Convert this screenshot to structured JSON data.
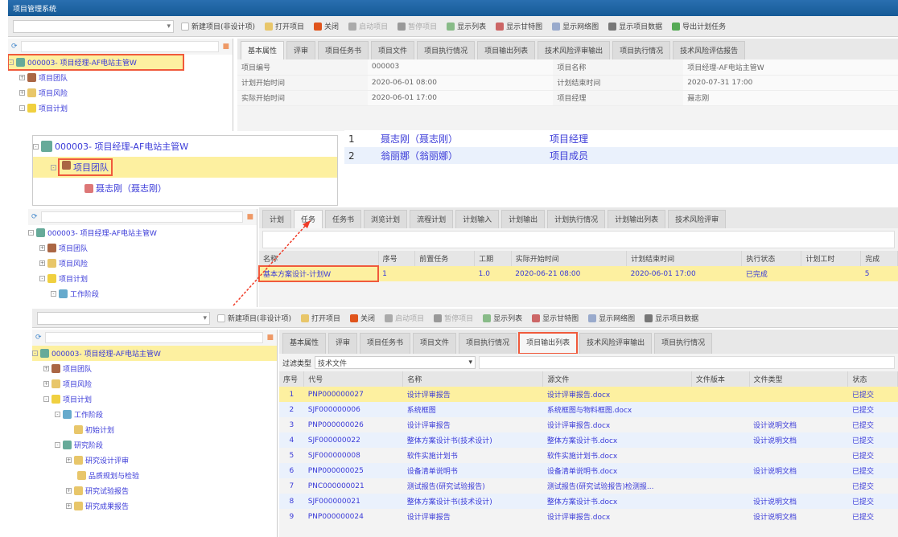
{
  "window": {
    "title": "项目管理系统"
  },
  "toolbar": {
    "items": [
      "新建项目(非设计项)",
      "打开项目",
      "关闭",
      "启动项目",
      "暂停项目",
      "显示列表",
      "显示甘特图",
      "显示网络图",
      "显示项目数据",
      "导出计划任务"
    ]
  },
  "tree": {
    "root": "000003- 项目经理-AF电站主管W",
    "nodes": [
      "项目团队",
      "项目风险",
      "项目计划",
      "工作阶段",
      "初始计划",
      "研究阶段",
      "研究设计评审",
      "品质规划与检验",
      "研究试验报告",
      "研究成果报告"
    ],
    "member": "聂志刚（聂志刚）"
  },
  "top_tabs": [
    "基本属性",
    "评审",
    "项目任务书",
    "项目文件",
    "项目执行情况",
    "项目输出列表",
    "技术风险评审输出",
    "项目执行情况",
    "技术风险评估报告"
  ],
  "form": [
    {
      "label": "项目编号",
      "value": "000003",
      "label2": "项目名称",
      "value2": "项目经理-AF电站主管W"
    },
    {
      "label": "计划开始时间",
      "value": "2020-06-01 08:00",
      "label2": "计划结束时间",
      "value2": "2020-07-31 17:00"
    },
    {
      "label": "实际开始时间",
      "value": "2020-06-01 17:00",
      "label2": "项目经理",
      "value2": "聂志刚"
    }
  ],
  "team": [
    {
      "no": "1",
      "name": "聂志刚（聂志刚）",
      "role": "项目经理"
    },
    {
      "no": "2",
      "name": "翁丽娜（翁丽娜）",
      "role": "项目成员"
    }
  ],
  "mid_tabs": [
    "计划",
    "任务",
    "任务书",
    "浏览计划",
    "流程计划",
    "计划输入",
    "计划输出",
    "计划执行情况",
    "计划输出列表",
    "技术风险评审"
  ],
  "mid_table": {
    "headers": [
      "名称",
      "序号",
      "前置任务",
      "工期",
      "实际开始时间",
      "计划结束时间",
      "执行状态",
      "计划工时",
      "完成"
    ],
    "row": [
      "基本方案设计-计划W",
      "1",
      "",
      "1.0",
      "2020-06-21 08:00",
      "2020-06-01 17:00",
      "已完成",
      "",
      "5"
    ]
  },
  "bottom_tabs": [
    "基本属性",
    "评审",
    "项目任务书",
    "项目文件",
    "项目执行情况",
    "项目输出列表",
    "技术风险评审输出",
    "项目执行情况"
  ],
  "filter": {
    "label": "过滤类型",
    "value": "技术文件"
  },
  "doc_table": {
    "headers": [
      "序号",
      "代号",
      "名称",
      "源文件",
      "文件版本",
      "文件类型",
      "状态"
    ],
    "rows": [
      [
        "1",
        "PNP000000027",
        "设计评审报告",
        "设计评审报告.docx",
        "",
        "",
        "已提交"
      ],
      [
        "2",
        "SJF000000006",
        "系统框图",
        "系统框图与物料框图.docx",
        "",
        "",
        "已提交"
      ],
      [
        "3",
        "PNP000000026",
        "设计评审报告",
        "设计评审报告.docx",
        "",
        "设计说明文档",
        "已提交"
      ],
      [
        "4",
        "SJF000000022",
        "整体方案设计书(技术设计)",
        "整体方案设计书.docx",
        "",
        "设计说明文档",
        "已提交"
      ],
      [
        "5",
        "SJF000000008",
        "软件实施计划书",
        "软件实施计划书.docx",
        "",
        "",
        "已提交"
      ],
      [
        "6",
        "PNP000000025",
        "设备清单说明书",
        "设备清单说明书.docx",
        "",
        "设计说明文档",
        "已提交"
      ],
      [
        "7",
        "PNC000000021",
        "测试报告(研究试验报告)",
        "测试报告(研究试验报告)检测报...",
        "",
        "",
        "已提交"
      ],
      [
        "8",
        "SJF000000021",
        "整体方案设计书(技术设计)",
        "整体方案设计书.docx",
        "",
        "设计说明文档",
        "已提交"
      ],
      [
        "9",
        "PNP000000024",
        "设计评审报告",
        "设计评审报告.docx",
        "",
        "设计说明文档",
        "已提交"
      ]
    ]
  }
}
